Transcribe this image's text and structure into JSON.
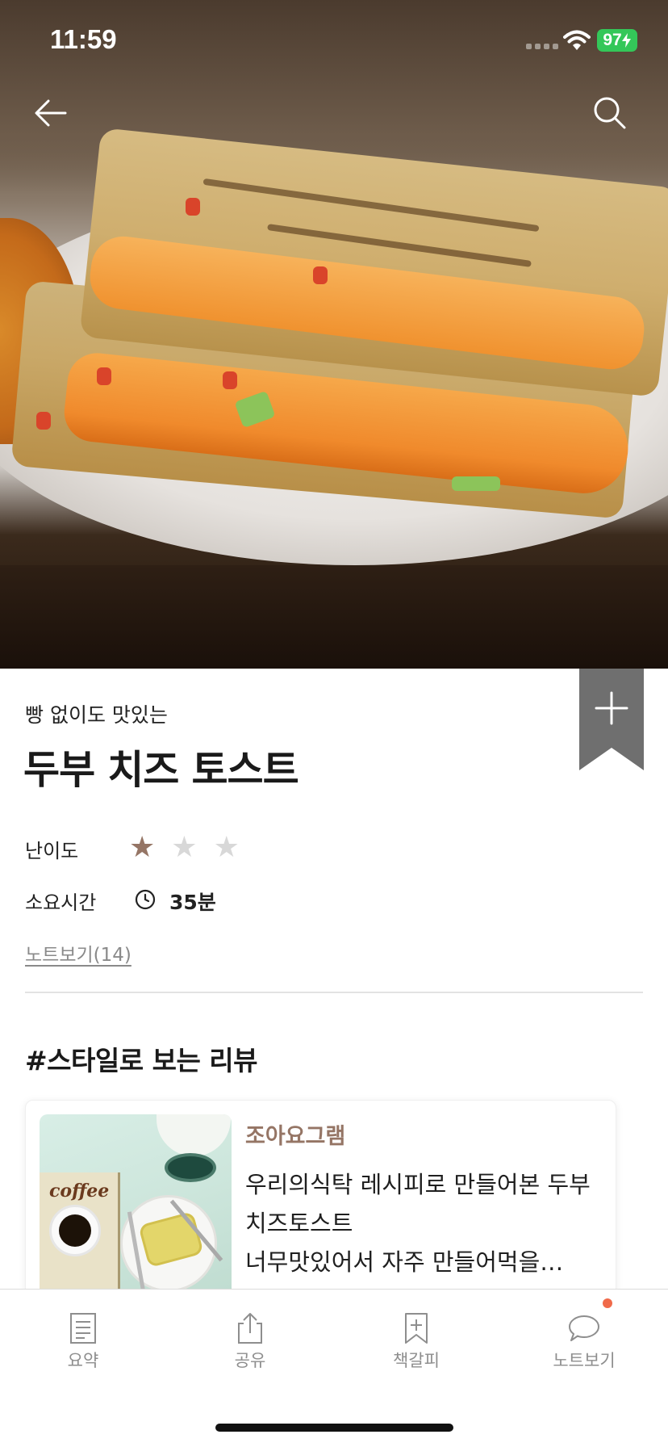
{
  "status_bar": {
    "time": "11:59",
    "battery": "97"
  },
  "hero": {
    "back_icon": "arrow-left-icon",
    "search_icon": "search-icon"
  },
  "recipe": {
    "subtitle": "빵 없이도 맛있는",
    "title": "두부 치즈 토스트",
    "difficulty_label": "난이도",
    "difficulty_rating": 1,
    "difficulty_max": 3,
    "time_label": "소요시간",
    "time_value": "35분",
    "notes_link": "노트보기(14)",
    "bookmark_icon": "plus-icon"
  },
  "reviews": {
    "section_title": "#스타일로 보는 리뷰",
    "items": [
      {
        "thumb_book_word": "coffee",
        "author": "조아요그램",
        "text": "우리의식탁 레시피로 만들어본 두부치즈토스트\n너무맛있어서 자주 만들어먹을…"
      }
    ]
  },
  "tabbar": {
    "items": [
      {
        "label": "요약",
        "icon": "document-icon"
      },
      {
        "label": "공유",
        "icon": "share-icon"
      },
      {
        "label": "책갈피",
        "icon": "bookmark-add-icon"
      },
      {
        "label": "노트보기",
        "icon": "chat-bubble-icon"
      }
    ]
  },
  "colors": {
    "accent": "#957565",
    "star_off": "#d8d8d8",
    "battery": "#34c759",
    "notification_dot": "#f06a4a"
  }
}
